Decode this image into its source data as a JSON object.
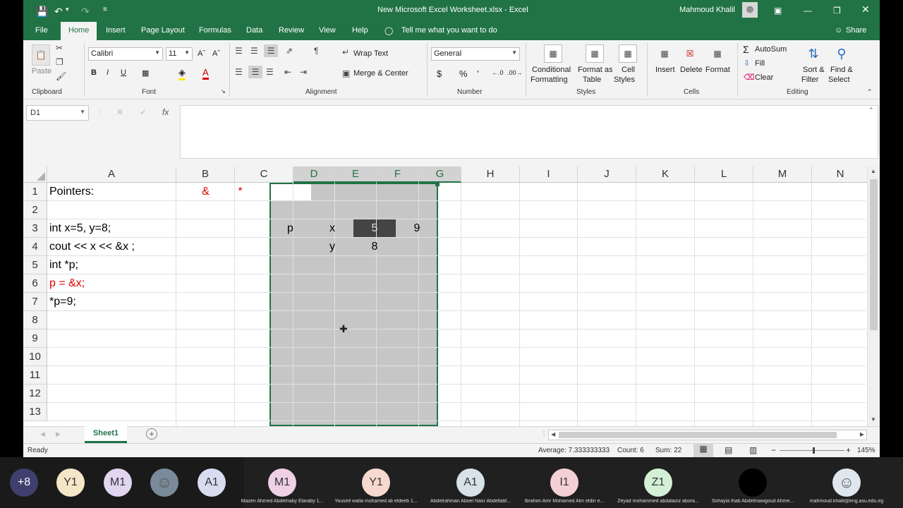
{
  "window": {
    "title": "New Microsoft Excel Worksheet.xlsx  -  Excel",
    "user": "Mahmoud Khalil"
  },
  "menu": {
    "file": "File",
    "home": "Home",
    "insert": "Insert",
    "page_layout": "Page Layout",
    "formulas": "Formulas",
    "data": "Data",
    "review": "Review",
    "view": "View",
    "help": "Help",
    "tell_me": "Tell me what you want to do",
    "share": "Share"
  },
  "ribbon": {
    "paste": "Paste",
    "clipboard": "Clipboard",
    "font_name": "Calibri",
    "font_size": "11",
    "font": "Font",
    "bold": "B",
    "italic": "I",
    "underline": "U",
    "wrap_text": "Wrap Text",
    "merge_center": "Merge & Center",
    "alignment": "Alignment",
    "number_format": "General",
    "currency": "$",
    "percent": "%",
    "comma": "’",
    "number": "Number",
    "cond_fmt_1": "Conditional",
    "cond_fmt_2": "Formatting",
    "fmt_table_1": "Format as",
    "fmt_table_2": "Table",
    "cell_styles_1": "Cell",
    "cell_styles_2": "Styles",
    "styles": "Styles",
    "insert": "Insert",
    "delete": "Delete",
    "format": "Format",
    "cells": "Cells",
    "autosum": "AutoSum",
    "fill": "Fill",
    "clear": "Clear",
    "sort_1": "Sort &",
    "sort_2": "Filter",
    "find_1": "Find &",
    "find_2": "Select",
    "editing": "Editing"
  },
  "formula_bar": {
    "name_box": "D1",
    "fx": "fx",
    "content": ""
  },
  "columns": [
    "A",
    "B",
    "C",
    "D",
    "E",
    "F",
    "G",
    "H",
    "I",
    "J",
    "K",
    "L",
    "M",
    "N"
  ],
  "rows": [
    "1",
    "2",
    "3",
    "4",
    "5",
    "6",
    "7",
    "8",
    "9",
    "10",
    "11",
    "12",
    "13"
  ],
  "cells": {
    "A1": "Pointers:",
    "B1": "&",
    "C1": "*",
    "A3": "int x=5, y=8;",
    "A4": "cout << x << &x ;",
    "A5": "int *p;",
    "A6": "p = &x;",
    "A7": "*p=9;",
    "D3": "p",
    "E3": "x",
    "F3": "5",
    "G3": "9",
    "E4": "y",
    "F4": "8"
  },
  "colors": {
    "excel_green": "#217346",
    "red_text": "#e00000",
    "selection_fill": "#c6c6c6",
    "dark_cell": "#444444"
  },
  "sheets": [
    {
      "name": "Sheet1",
      "active": true
    }
  ],
  "status": {
    "ready": "Ready",
    "average": "Average: 7.333333333",
    "count": "Count: 6",
    "sum": "Sum: 22",
    "zoom": "145%"
  },
  "participants": [
    {
      "initials": "+8",
      "name": "",
      "color": "#3f3f6e"
    },
    {
      "initials": "Y1",
      "name": "",
      "color": "#f5e6c8"
    },
    {
      "initials": "M1",
      "name": "",
      "color": "#e0d6f0"
    },
    {
      "initials": "",
      "name": "",
      "color": "#7a8a9a",
      "photo": true
    },
    {
      "initials": "A1",
      "name": "",
      "color": "#d8dcf0"
    },
    {
      "initials": "M1",
      "name": "Mazen Ahmed Abdelnaby Elaraby 1...",
      "color": "#f0d0e6"
    },
    {
      "initials": "Y1",
      "name": "Youseif walla mohamed ali eldeeb 1...",
      "color": "#f7d9cf"
    },
    {
      "initials": "A1",
      "name": "Abdelrahman Aboel Nasr Abdellatif...",
      "color": "#d6e2e8"
    },
    {
      "initials": "I1",
      "name": "Ibrahim Amr Mohamed Alm eldin e...",
      "color": "#f4d0d6"
    },
    {
      "initials": "Z1",
      "name": "Zeyad mohammed abdalaziz abora...",
      "color": "#d3efd6"
    },
    {
      "initials": "",
      "name": "Sohayla Ihab Abdelmawgoud Ahme...",
      "color": "#000000"
    },
    {
      "initials": "",
      "name": "mahmoud.khalil@eng.asu.edu.eg",
      "color": "#dfe6ee",
      "photo": true
    }
  ]
}
